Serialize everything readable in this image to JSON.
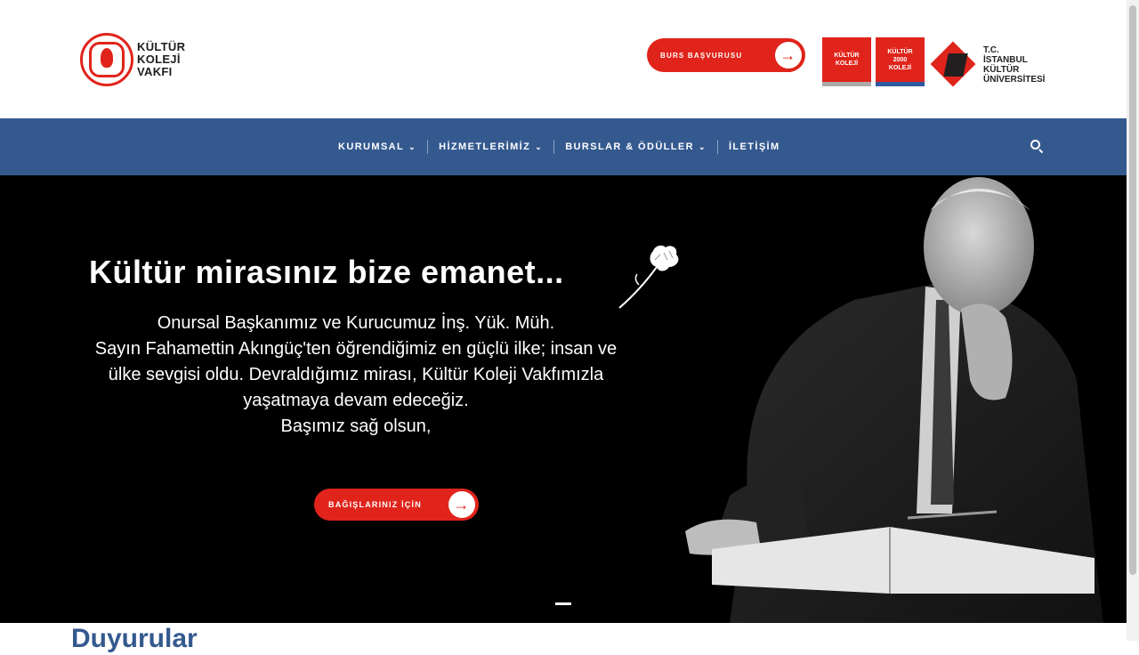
{
  "header": {
    "logo": {
      "lines": [
        "KÜLTÜR",
        "KOLEJİ",
        "VAKFI"
      ]
    },
    "burs_button": "BURS BAŞVURUSU",
    "badges": [
      {
        "lines": [
          "KÜLTÜR",
          "KOLEJİ"
        ]
      },
      {
        "lines": [
          "KÜLTÜR",
          "2000",
          "KOLEJİ"
        ]
      }
    ],
    "university": {
      "lines": [
        "T.C.",
        "İSTANBUL",
        "KÜLTÜR",
        "ÜNİVERSİTESİ"
      ]
    }
  },
  "nav": {
    "items": [
      {
        "label": "KURUMSAL",
        "has_dropdown": true
      },
      {
        "label": "HİZMETLERİMİZ",
        "has_dropdown": true
      },
      {
        "label": "BURSLAR & ÖDÜLLER",
        "has_dropdown": true
      },
      {
        "label": "İLETİŞİM",
        "has_dropdown": false
      }
    ],
    "search_icon": "search-icon"
  },
  "hero": {
    "title": "Kültür mirasınız bize emanet...",
    "lines": [
      "Onursal Başkanımız ve Kurucumuz İnş. Yük. Müh.",
      "Sayın Fahamettin Akıngüç'ten öğrendiğimiz en güçlü ilke; insan ve",
      "ülke sevgisi oldu. Devraldığımız mirası, Kültür Koleji Vakfımızla",
      "yaşatmaya devam edeceğiz.",
      "Başımız sağ olsun,"
    ],
    "donate_button": "BAĞIŞLARINIZ İÇİN"
  },
  "section": {
    "heading": "Duyurular"
  },
  "colors": {
    "accent_red": "#e0241b",
    "nav_blue": "#34598f",
    "hero_bg": "#000000"
  }
}
